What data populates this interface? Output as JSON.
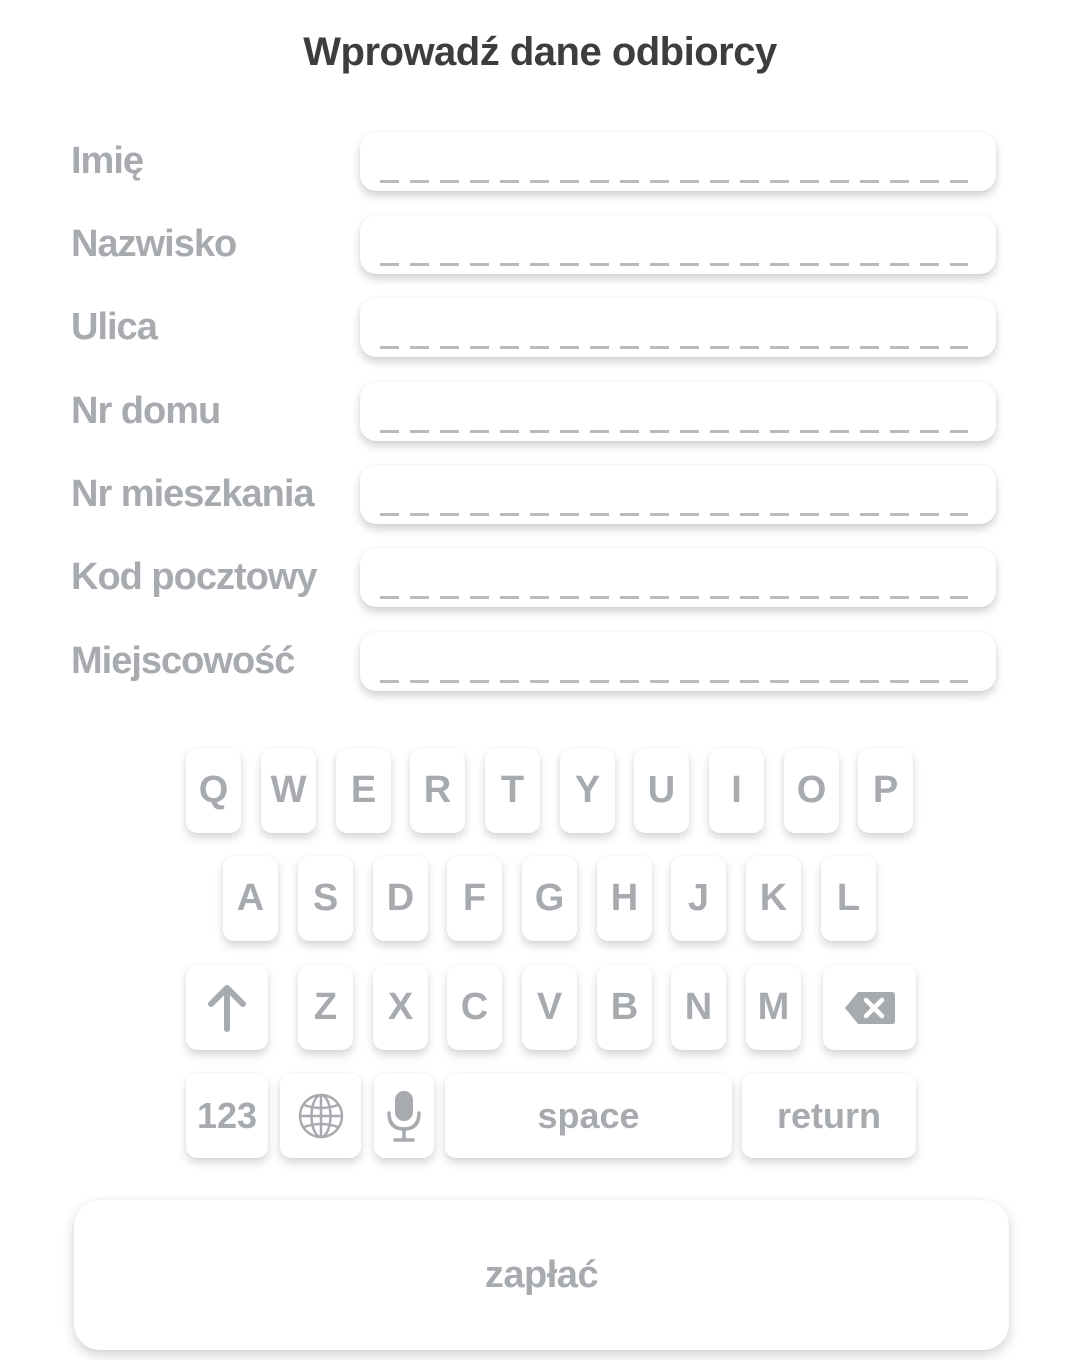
{
  "title": "Wprowadź dane odbiorcy",
  "form": {
    "fields": [
      {
        "label": "Imię"
      },
      {
        "label": "Nazwisko"
      },
      {
        "label": "Ulica"
      },
      {
        "label": "Nr domu"
      },
      {
        "label": "Nr mieszkania"
      },
      {
        "label": "Kod pocztowy"
      },
      {
        "label": "Miejscowość"
      }
    ]
  },
  "keyboard": {
    "row1": [
      "Q",
      "W",
      "E",
      "R",
      "T",
      "Y",
      "U",
      "I",
      "O",
      "P"
    ],
    "row2": [
      "A",
      "S",
      "D",
      "F",
      "G",
      "H",
      "J",
      "K",
      "L"
    ],
    "row3": [
      "Z",
      "X",
      "C",
      "V",
      "B",
      "N",
      "M"
    ],
    "shift_icon": "arrow-up-icon",
    "backspace_icon": "backspace-icon",
    "numbers_label": "123",
    "globe_icon": "globe-icon",
    "mic_icon": "microphone-icon",
    "space_label": "space",
    "return_label": "return"
  },
  "pay_button": {
    "label": "zapłać"
  },
  "colors": {
    "title": "#3d3d3d",
    "label": "#a7abaf",
    "dash": "#b8bcc0",
    "background": "#ffffff"
  }
}
